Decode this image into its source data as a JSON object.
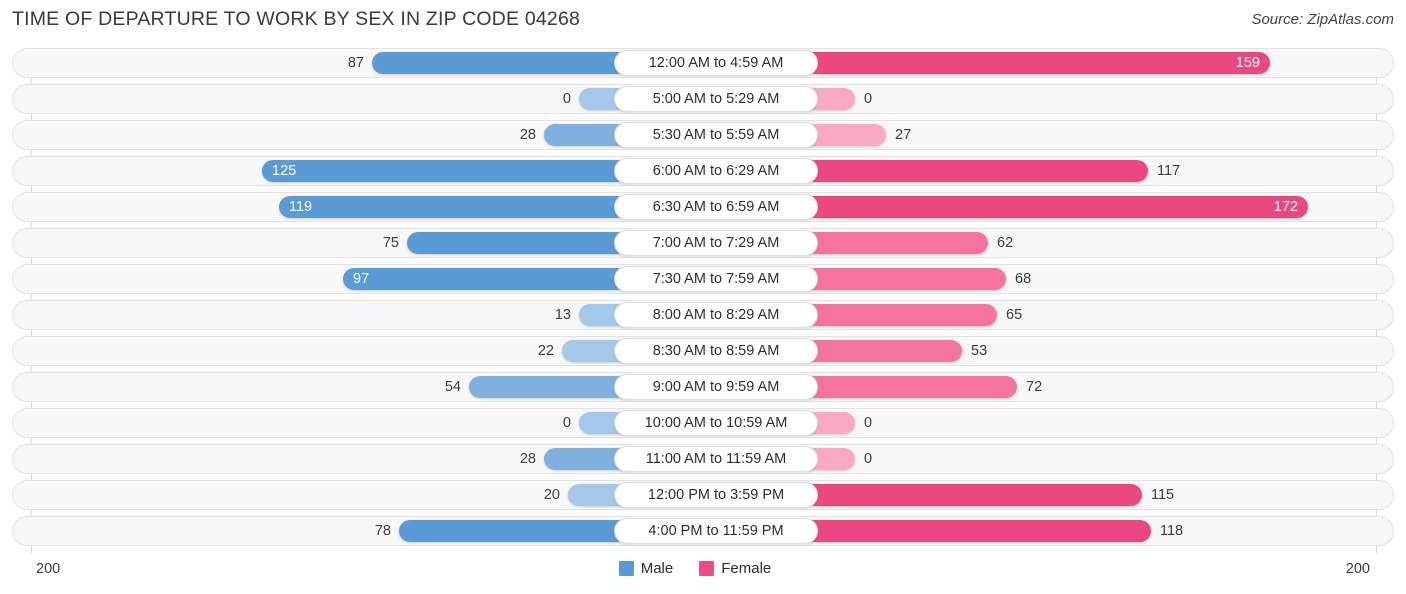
{
  "header": {
    "title": "TIME OF DEPARTURE TO WORK BY SEX IN ZIP CODE 04268",
    "source": "Source: ZipAtlas.com"
  },
  "axis": {
    "left_label": "200",
    "right_label": "200",
    "max": 200
  },
  "legend": {
    "items": [
      {
        "label": "Male",
        "color": "#5b9bd5"
      },
      {
        "label": "Female",
        "color": "#ec4c81"
      }
    ]
  },
  "colors": {
    "male_strong": "#5b9bd5",
    "male_mid": "#80b0de",
    "male_light": "#a4c8e9",
    "female_strong": "#ea4880",
    "female_mid": "#f4749f",
    "female_light": "#f9a8c4",
    "track_bg": "#f7f7f7",
    "track_border": "#e2e2e2",
    "gridline": "#d9d9d9",
    "title": "#3a3a3a"
  },
  "chart_data": {
    "type": "bar",
    "title": "TIME OF DEPARTURE TO WORK BY SEX IN ZIP CODE 04268",
    "subtitle": "",
    "xlabel": "",
    "ylabel": "",
    "orientation": "horizontal-diverging",
    "xlim": [
      200,
      200
    ],
    "grid": true,
    "legend_position": "bottom-center",
    "categories": [
      "12:00 AM to 4:59 AM",
      "5:00 AM to 5:29 AM",
      "5:30 AM to 5:59 AM",
      "6:00 AM to 6:29 AM",
      "6:30 AM to 6:59 AM",
      "7:00 AM to 7:29 AM",
      "7:30 AM to 7:59 AM",
      "8:00 AM to 8:29 AM",
      "8:30 AM to 8:59 AM",
      "9:00 AM to 9:59 AM",
      "10:00 AM to 10:59 AM",
      "11:00 AM to 11:59 AM",
      "12:00 PM to 3:59 PM",
      "4:00 PM to 11:59 PM"
    ],
    "series": [
      {
        "name": "Male",
        "color": "#5b9bd5",
        "values": [
          87,
          0,
          28,
          125,
          119,
          75,
          97,
          13,
          22,
          54,
          0,
          28,
          20,
          78
        ]
      },
      {
        "name": "Female",
        "color": "#ec4c81",
        "values": [
          159,
          0,
          27,
          117,
          172,
          62,
          68,
          65,
          53,
          72,
          0,
          0,
          115,
          118
        ]
      }
    ]
  }
}
